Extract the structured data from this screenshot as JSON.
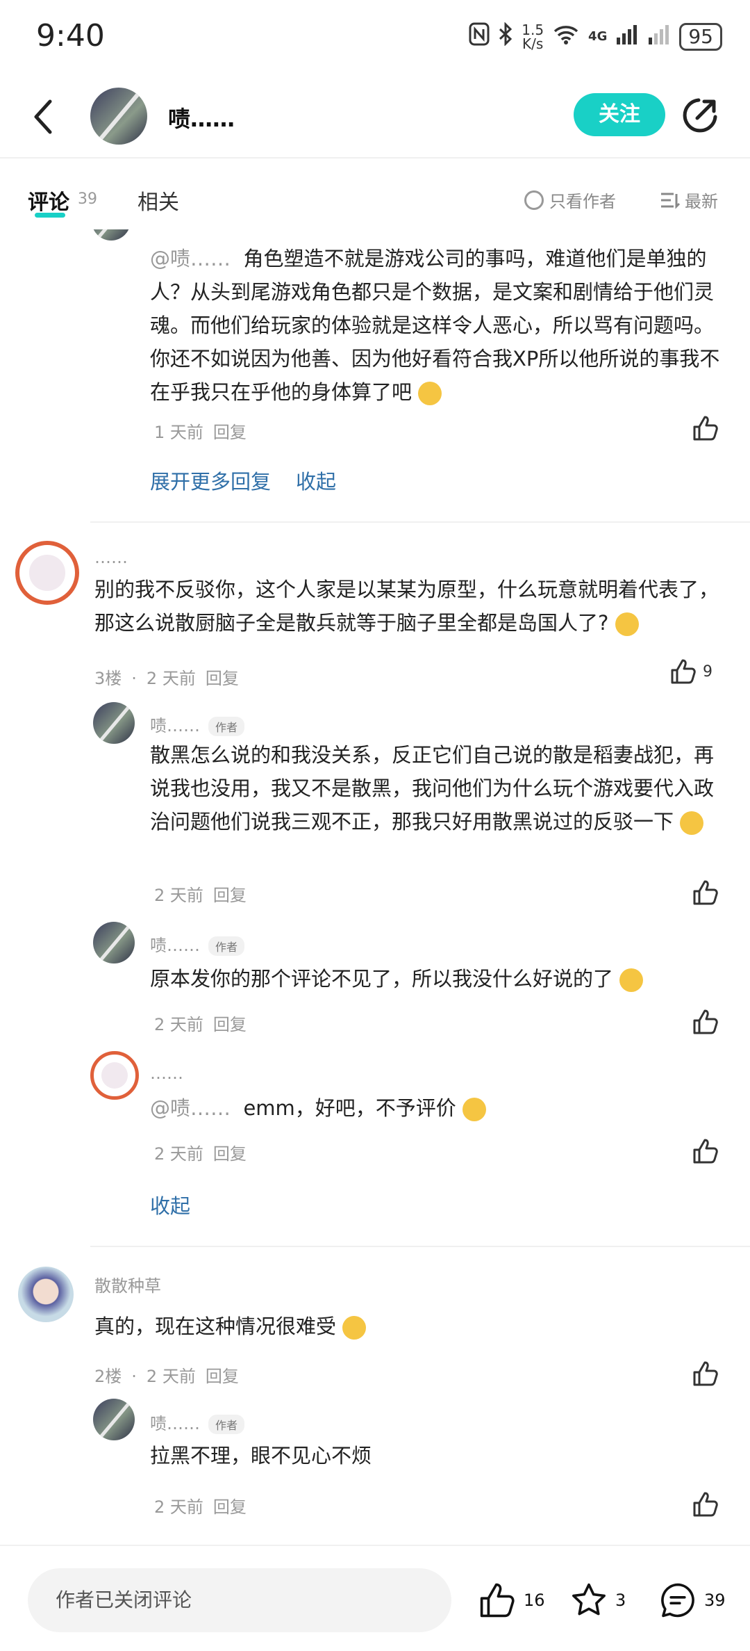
{
  "status_bar": {
    "time": "9:40",
    "net_speed_value": "1.5",
    "net_speed_unit": "K/s",
    "network": "4G",
    "battery": "95"
  },
  "header": {
    "author_name": "啧……",
    "follow_label": "关注"
  },
  "tabs": {
    "comments_label": "评论",
    "comments_count": "39",
    "related_label": "相关",
    "only_author_label": "只看作者",
    "sort_label": "最新"
  },
  "comments": {
    "reply_top": {
      "mention": "@啧……",
      "text": "角色塑造不就是游戏公司的事吗，难道他们是单独的人？从头到尾游戏角色都只是个数据，是文案和剧情给于他们灵魂。而他们给玩家的体验就是这样令人恶心，所以骂有问题吗。你还不如说因为他善、因为他好看符合我XP所以他所说的事我不在乎我只在乎他的身体算了吧",
      "time": "1 天前",
      "reply_label": "回复",
      "expand_label": "展开更多回复",
      "collapse_label": "收起"
    },
    "floor3": {
      "username": "……",
      "text": "别的我不反驳你，这个人家是以某某为原型，什么玩意就明着代表了，那这么说散厨脑子全是散兵就等于脑子里全都是岛国人了?",
      "floor": "3楼",
      "time": "2 天前",
      "reply_label": "回复",
      "likes": "9",
      "replies": [
        {
          "username": "啧……",
          "tag": "作者",
          "text": "散黑怎么说的和我没关系，反正它们自己说的散是稻妻战犯，再说我也没用，我又不是散黑，我问他们为什么玩个游戏要代入政治问题他们说我三观不正，那我只好用散黑说过的反驳一下",
          "time": "2 天前",
          "reply_label": "回复"
        },
        {
          "username": "啧……",
          "tag": "作者",
          "text": "原本发你的那个评论不见了，所以我没什么好说的了",
          "time": "2 天前",
          "reply_label": "回复"
        },
        {
          "username": "……",
          "mention": "@啧……",
          "text": "emm，好吧，不予评价",
          "time": "2 天前",
          "reply_label": "回复"
        }
      ],
      "collapse_label": "收起"
    },
    "floor2": {
      "username": "散散种草",
      "text": "真的，现在这种情况很难受",
      "floor": "2楼",
      "time": "2 天前",
      "reply_label": "回复",
      "replies": [
        {
          "username": "啧……",
          "tag": "作者",
          "text": "拉黑不理，眼不见心不烦",
          "time": "2 天前",
          "reply_label": "回复"
        }
      ]
    }
  },
  "bottom_bar": {
    "closed_text": "作者已关闭评论",
    "likes": "16",
    "favorites": "3",
    "comments": "39"
  },
  "colors": {
    "accent": "#19d0c6",
    "link": "#2f6fa8",
    "muted": "#999999"
  }
}
